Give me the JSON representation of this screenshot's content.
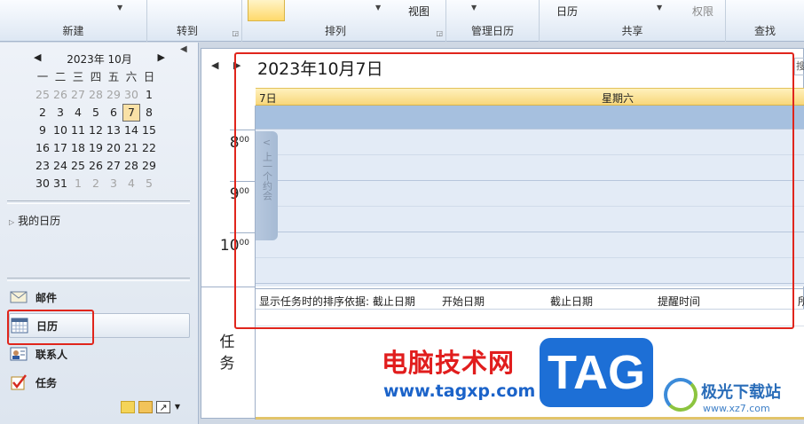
{
  "ribbon": {
    "groups": [
      "新建",
      "转到",
      "排列",
      "管理日历",
      "共享",
      "查找"
    ],
    "view_label": "视图",
    "calendar_dropdown": "日历",
    "permission_label": "权限"
  },
  "mini_calendar": {
    "title": "2023年 10月",
    "weekdays": [
      "一",
      "二",
      "三",
      "四",
      "五",
      "六",
      "日"
    ],
    "weeks": [
      [
        "25",
        "26",
        "27",
        "28",
        "29",
        "30",
        "1"
      ],
      [
        "2",
        "3",
        "4",
        "5",
        "6",
        "7",
        "8"
      ],
      [
        "9",
        "10",
        "11",
        "12",
        "13",
        "14",
        "15"
      ],
      [
        "16",
        "17",
        "18",
        "19",
        "20",
        "21",
        "22"
      ],
      [
        "23",
        "24",
        "25",
        "26",
        "27",
        "28",
        "29"
      ],
      [
        "30",
        "31",
        "1",
        "2",
        "3",
        "4",
        "5"
      ]
    ],
    "selected": "7"
  },
  "folders": {
    "my_calendars": "我的日历"
  },
  "nav": {
    "mail": "邮件",
    "calendar": "日历",
    "contacts": "联系人",
    "tasks": "任务"
  },
  "day_view": {
    "title": "2023年10月7日",
    "date_label": "7日",
    "weekday": "星期六",
    "search_stub": "搜",
    "hours": [
      {
        "h": "8",
        "m": "00"
      },
      {
        "h": "9",
        "m": "00"
      },
      {
        "h": "10",
        "m": "00"
      }
    ],
    "prev_appointment": "上一个约会",
    "tasks_sort_label": "显示任务时的排序依据: 截止日期",
    "task_columns": [
      "开始日期",
      "截止日期",
      "提醒时间"
    ],
    "task_col_cut": "所",
    "tasks_vertical": "任务"
  },
  "watermark": {
    "cn_text": "电脑技术网",
    "tag": "TAG",
    "url": "www.tagxp.com",
    "site2_name": "极光下载站",
    "site2_url": "www.xz7.com"
  },
  "colors": {
    "highlight_red": "#e0251c",
    "date_band": "#f8d77a",
    "slot_bg": "#e3ebf6"
  }
}
